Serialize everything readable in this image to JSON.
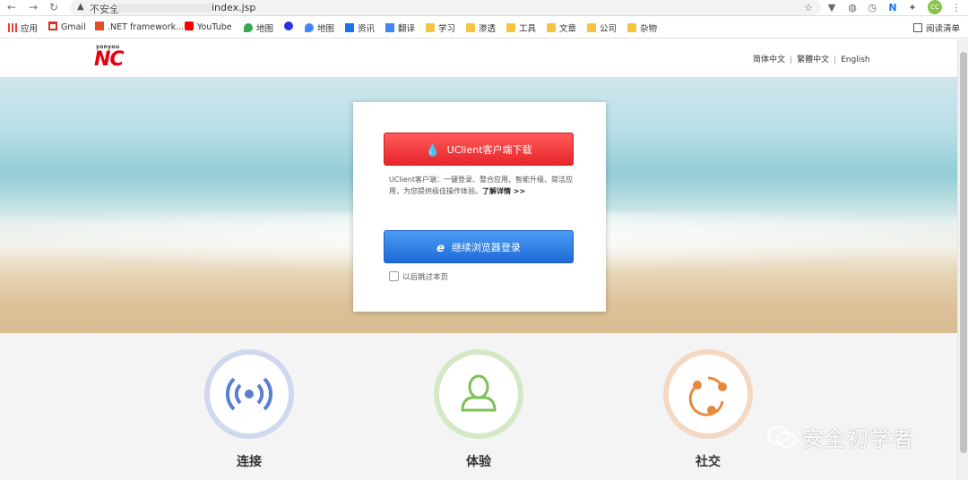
{
  "browser": {
    "insecure_label": "不安全",
    "url_path": "index.jsp",
    "avatar_initials": "CC"
  },
  "bookmarks": [
    {
      "label": "应用",
      "icon": "apps-grid-icon"
    },
    {
      "label": "Gmail",
      "icon": "gmail-icon"
    },
    {
      "label": ".NET framework...",
      "icon": "c-icon"
    },
    {
      "label": "YouTube",
      "icon": "youtube-icon"
    },
    {
      "label": "地图",
      "icon": "maps-icon"
    },
    {
      "label": "",
      "icon": "baidu-paw-icon"
    },
    {
      "label": "地图",
      "icon": "maps-icon"
    },
    {
      "label": "资讯",
      "icon": "news-icon"
    },
    {
      "label": "翻译",
      "icon": "translate-icon"
    },
    {
      "label": "学习",
      "icon": "folder-icon"
    },
    {
      "label": "渗透",
      "icon": "folder-icon"
    },
    {
      "label": "工具",
      "icon": "folder-icon"
    },
    {
      "label": "文章",
      "icon": "folder-icon"
    },
    {
      "label": "公司",
      "icon": "folder-icon"
    },
    {
      "label": "杂物",
      "icon": "folder-icon"
    }
  ],
  "reading_list": "阅读清单",
  "header": {
    "logo_small": "yonyou",
    "logo_main": "NC",
    "lang_simplified": "简体中文",
    "lang_traditional": "繁體中文",
    "lang_english": "English"
  },
  "card": {
    "download_button": "UClient客户端下载",
    "desc_text": "UClient客户端：一键登录、整合应用、智能升级、简洁应用，为您提供极佳操作体验。",
    "learn_more": "了解详情 >>",
    "browser_login_button": "继续浏览器登录",
    "skip_label": "以后跳过本页"
  },
  "features": [
    {
      "label": "连接",
      "icon": "connection-signal-icon",
      "color": "#5b7fd0"
    },
    {
      "label": "体验",
      "icon": "user-person-icon",
      "color": "#7fbf57"
    },
    {
      "label": "社交",
      "icon": "social-share-icon",
      "color": "#e8883a"
    }
  ],
  "watermark": "安全初学者"
}
